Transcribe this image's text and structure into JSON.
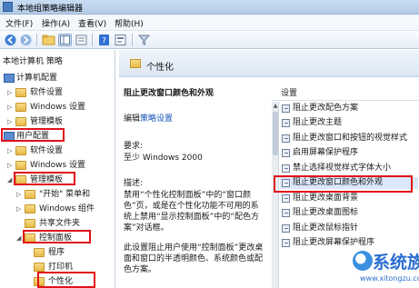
{
  "window": {
    "title": "本地组策略编辑器"
  },
  "menu": [
    "文件(F)",
    "操作(A)",
    "查看(V)",
    "帮助(H)"
  ],
  "tree": {
    "root_label": "本地计算机 策略",
    "items": [
      {
        "label": "计算机配置",
        "kind": "config"
      },
      {
        "label": "软件设置",
        "kind": "folder"
      },
      {
        "label": "Windows 设置",
        "kind": "folder"
      },
      {
        "label": "管理模板",
        "kind": "folder"
      },
      {
        "label": "用户配置",
        "kind": "config"
      },
      {
        "label": "软件设置",
        "kind": "folder"
      },
      {
        "label": "Windows 设置",
        "kind": "folder"
      },
      {
        "label": "管理模板",
        "kind": "folder"
      },
      {
        "label": "\"开始\" 菜单和",
        "kind": "folder"
      },
      {
        "label": "Windows 组件",
        "kind": "folder"
      },
      {
        "label": "共享文件夹",
        "kind": "folder"
      },
      {
        "label": "控制面板",
        "kind": "folder"
      },
      {
        "label": "程序",
        "kind": "folder"
      },
      {
        "label": "打印机",
        "kind": "folder"
      },
      {
        "label": "个性化",
        "kind": "folder"
      }
    ]
  },
  "header": {
    "title": "个性化"
  },
  "description": {
    "title": "阻止更改窗口颜色和外观",
    "edit_prefix": "编辑",
    "edit_link": "策略设置",
    "requirement_label": "要求:",
    "requirement_value": "至少 Windows 2000",
    "desc_label": "描述:",
    "desc_text": "禁用“个性化控制面板”中的“窗口颜色”页，或是在个性化功能不可用的系统上禁用“显示控制面板”中的“配色方案”对话框。",
    "desc_text2": "此设置阻止用户使用“控制面板”更改桌面和窗口的半透明颜色、系统颜色或配色方案。"
  },
  "settings": {
    "column_label": "设置",
    "items": [
      "阻止更改配色方案",
      "阻止更改主题",
      "阻止更改窗口和按钮的视觉样式",
      "启用屏幕保护程序",
      "禁止选择视觉样式字体大小",
      "阻止更改窗口颜色和外观",
      "阻止更改桌面背景",
      "阻止更改桌面图标",
      "阻止更改鼠标指针",
      "阻止更改屏幕保护程序"
    ],
    "selected_index": 5
  },
  "watermark": {
    "text": "系统族",
    "url": "www.xitongzu.com"
  },
  "colors": {
    "highlight_border": "#e0111a",
    "link": "#1a55b8",
    "selection": "#dbe7fb"
  }
}
